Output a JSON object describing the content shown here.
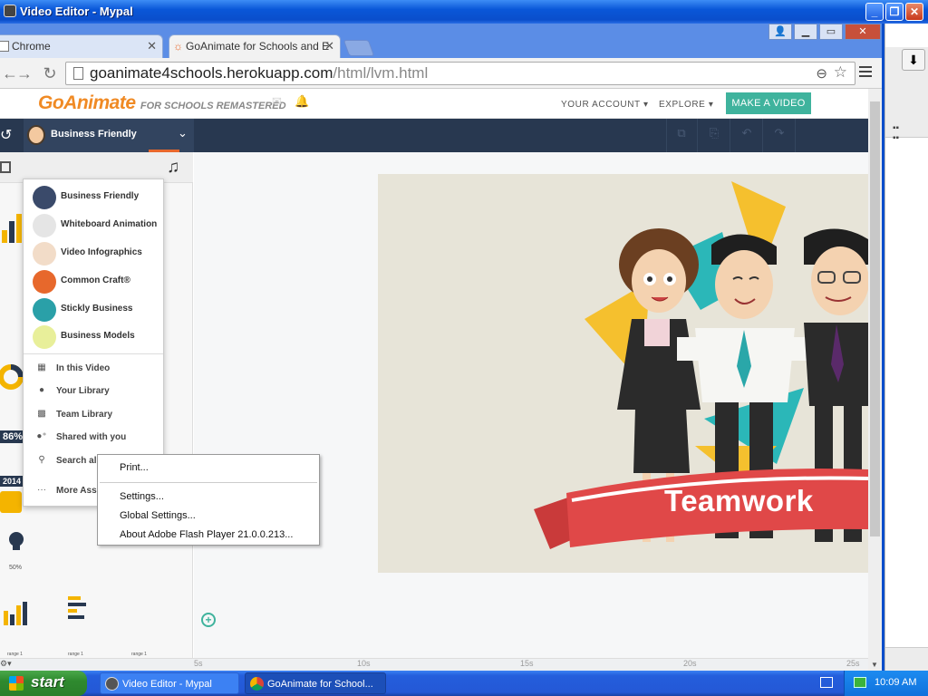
{
  "window": {
    "title": "Video Editor - Mypal"
  },
  "browser": {
    "tabs": [
      {
        "label": "Chrome"
      },
      {
        "label": "GoAnimate for Schools and E"
      }
    ],
    "url_host": "goanimate4schools.herokuapp.com",
    "url_path": "/html/lvm.html"
  },
  "site": {
    "logo_main": "GoAnimate",
    "logo_sub": "FOR SCHOOLS REMASTERED",
    "nav": {
      "account": "YOUR ACCOUNT",
      "explore": "EXPLORE",
      "make_video": "MAKE A VIDEO"
    },
    "theme_selected": "Business Friendly"
  },
  "theme_menu": {
    "themes": [
      {
        "label": "Business Friendly",
        "color": "#3a4a6a"
      },
      {
        "label": "Whiteboard Animation",
        "color": "#e5e5e5"
      },
      {
        "label": "Video Infographics",
        "color": "#f2dcc8"
      },
      {
        "label": "Common Craft®",
        "color": "#e7682c"
      },
      {
        "label": "Stickly Business",
        "color": "#2aa0a8"
      },
      {
        "label": "Business Models",
        "color": "#e8ef9a"
      }
    ],
    "libraries": [
      {
        "icon": "film-icon",
        "label": "In this Video"
      },
      {
        "icon": "user-icon",
        "label": "Your Library"
      },
      {
        "icon": "grid-icon",
        "label": "Team Library"
      },
      {
        "icon": "shared-user-icon",
        "label": "Shared with you"
      },
      {
        "icon": "search-icon",
        "label": "Search all themes"
      },
      {
        "icon": "more-icon",
        "label": "More Assets"
      }
    ]
  },
  "asset_labels": {
    "percent": "86%",
    "year": "2014",
    "small_percent": "50%",
    "range": "range 1"
  },
  "scene": {
    "banner_text": "Teamwork"
  },
  "context_menu": {
    "print": "Print...",
    "settings": "Settings...",
    "global_settings": "Global Settings...",
    "about": "About Adobe Flash Player 21.0.0.213..."
  },
  "timeline": {
    "ticks": [
      "5s",
      "10s",
      "15s",
      "20s",
      "25s"
    ]
  },
  "taskbar": {
    "start": "start",
    "tasks": [
      {
        "label": "Video Editor - Mypal"
      },
      {
        "label": "GoAnimate for School..."
      }
    ],
    "clock": "10:09 AM"
  },
  "colors": {
    "accent": "#3fb39d",
    "nav_bar": "#283850",
    "logo": "#f08a24",
    "banner": "#e04848"
  }
}
